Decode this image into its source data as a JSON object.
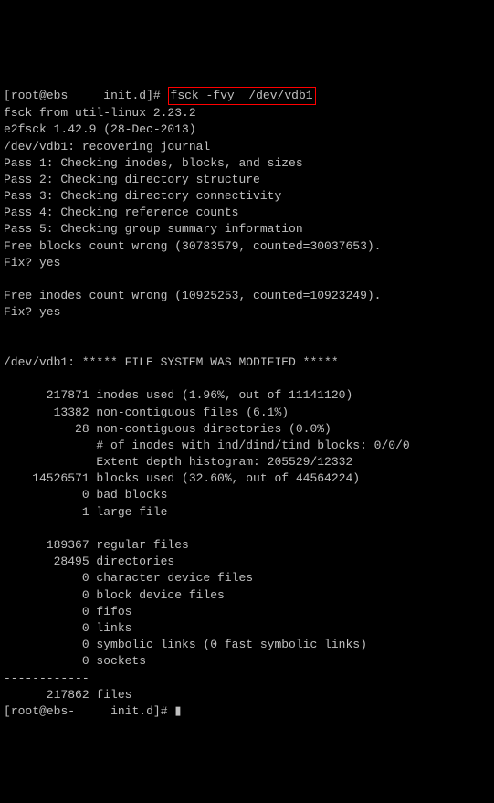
{
  "prompt1": {
    "user": "root",
    "host": "ebs",
    "redacted": "    ",
    "dir": "init.d",
    "sep": "]#",
    "command": "fsck -fvy  /dev/vdb1"
  },
  "output": {
    "l1": "fsck from util-linux 2.23.2",
    "l2": "e2fsck 1.42.9 (28-Dec-2013)",
    "l3": "/dev/vdb1: recovering journal",
    "l4": "Pass 1: Checking inodes, blocks, and sizes",
    "l5": "Pass 2: Checking directory structure",
    "l6": "Pass 3: Checking directory connectivity",
    "l7": "Pass 4: Checking reference counts",
    "l8": "Pass 5: Checking group summary information",
    "l9": "Free blocks count wrong (30783579, counted=30037653).",
    "l10": "Fix? yes",
    "l11": "",
    "l12": "Free inodes count wrong (10925253, counted=10923249).",
    "l13": "Fix? yes",
    "l14": "",
    "l15": "",
    "l16": "/dev/vdb1: ***** FILE SYSTEM WAS MODIFIED *****",
    "l17": "",
    "l18": "      217871 inodes used (1.96%, out of 11141120)",
    "l19": "       13382 non-contiguous files (6.1%)",
    "l20": "          28 non-contiguous directories (0.0%)",
    "l21": "             # of inodes with ind/dind/tind blocks: 0/0/0",
    "l22": "             Extent depth histogram: 205529/12332",
    "l23": "    14526571 blocks used (32.60%, out of 44564224)",
    "l24": "           0 bad blocks",
    "l25": "           1 large file",
    "l26": "",
    "l27": "      189367 regular files",
    "l28": "       28495 directories",
    "l29": "           0 character device files",
    "l30": "           0 block device files",
    "l31": "           0 fifos",
    "l32": "           0 links",
    "l33": "           0 symbolic links (0 fast symbolic links)",
    "l34": "           0 sockets",
    "l35": "------------",
    "l36": "      217862 files"
  },
  "prompt2": {
    "user": "root",
    "host": "ebs-",
    "redacted": "    ",
    "dir": "init.d",
    "sep": "]#",
    "cursor": "▮"
  }
}
